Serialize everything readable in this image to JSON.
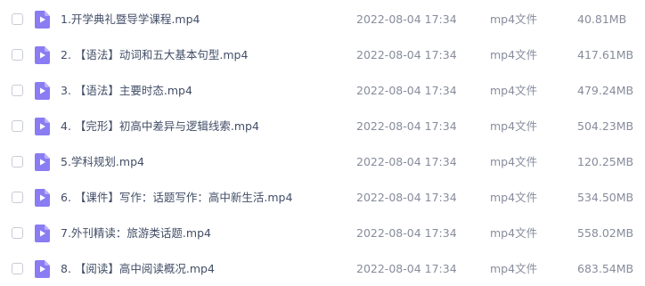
{
  "icon_color": "#8a7cf2",
  "file_icon": "video-file-icon",
  "files": [
    {
      "name": "1.开学典礼暨导学课程.mp4",
      "time": "2022-08-04 17:34",
      "type": "mp4文件",
      "size": "40.81MB"
    },
    {
      "name": "2. 【语法】动词和五大基本句型.mp4",
      "time": "2022-08-04 17:34",
      "type": "mp4文件",
      "size": "417.61MB"
    },
    {
      "name": "3. 【语法】主要时态.mp4",
      "time": "2022-08-04 17:34",
      "type": "mp4文件",
      "size": "479.24MB"
    },
    {
      "name": "4. 【完形】初高中差异与逻辑线索.mp4",
      "time": "2022-08-04 17:34",
      "type": "mp4文件",
      "size": "504.23MB"
    },
    {
      "name": "5.学科规划.mp4",
      "time": "2022-08-04 17:34",
      "type": "mp4文件",
      "size": "120.25MB"
    },
    {
      "name": "6. 【课件】写作：话题写作：高中新生活.mp4",
      "time": "2022-08-04 17:34",
      "type": "mp4文件",
      "size": "534.50MB"
    },
    {
      "name": "7.外刊精读：旅游类话题.mp4",
      "time": "2022-08-04 17:34",
      "type": "mp4文件",
      "size": "558.02MB"
    },
    {
      "name": "8. 【阅读】高中阅读概况.mp4",
      "time": "2022-08-04 17:34",
      "type": "mp4文件",
      "size": "683.54MB"
    }
  ]
}
